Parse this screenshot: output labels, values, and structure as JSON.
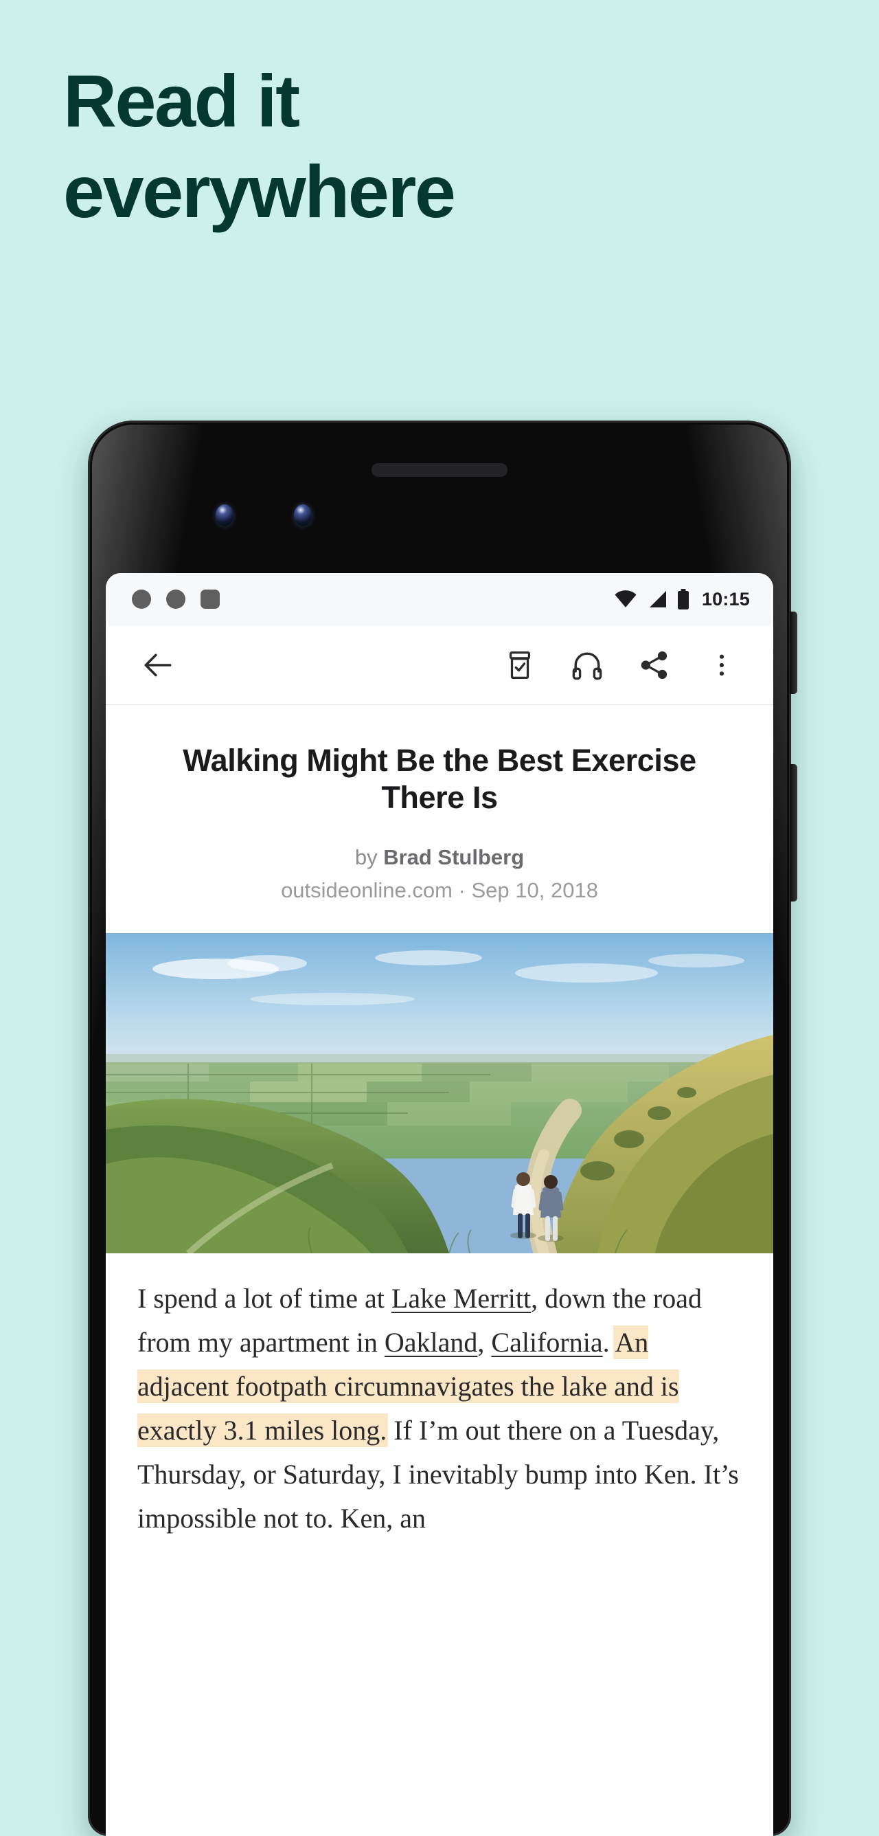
{
  "promo": {
    "headline_line1": "Read it",
    "headline_line2": "everywhere",
    "bg_color": "#ccf0ec",
    "headline_color": "#043830"
  },
  "phone": {
    "device_style": "pixel-3",
    "bezel_color": "#0b0b0c"
  },
  "statusbar": {
    "notification_icons": [
      "circle-dot-icon",
      "circle-dot-icon",
      "rounded-square-icon"
    ],
    "wifi_icon": "wifi-icon",
    "signal_icon": "cell-signal-icon",
    "battery_icon": "battery-full-icon",
    "time": "10:15"
  },
  "toolbar": {
    "back": "back-arrow-icon",
    "archive": "archive-check-icon",
    "listen": "headphones-icon",
    "share": "share-icon",
    "more": "overflow-menu-icon"
  },
  "article": {
    "title": "Walking Might Be the Best Exercise There Is",
    "byline_prefix": "by ",
    "author": "Brad Stulberg",
    "source": "outsideonline.com · Sep 10, 2018",
    "hero_alt": "Two hikers walking a grassy ridge trail over green farmland",
    "body": {
      "s1": "I spend a lot of time at ",
      "link1": "Lake Merritt",
      "s2": ", down the road from my apartment in ",
      "link2": "Oakland",
      "s3": ", ",
      "link3": "California",
      "s4": ". ",
      "highlight": "An adjacent footpath circumnavigates the lake and is exactly 3.1 miles long.",
      "s5": " If I’m out there on a Tuesday, Thursday, or Saturday, I inevitably bump into Ken. It’s impossible not to. Ken, an"
    },
    "highlight_color": "#fbe7c6"
  }
}
